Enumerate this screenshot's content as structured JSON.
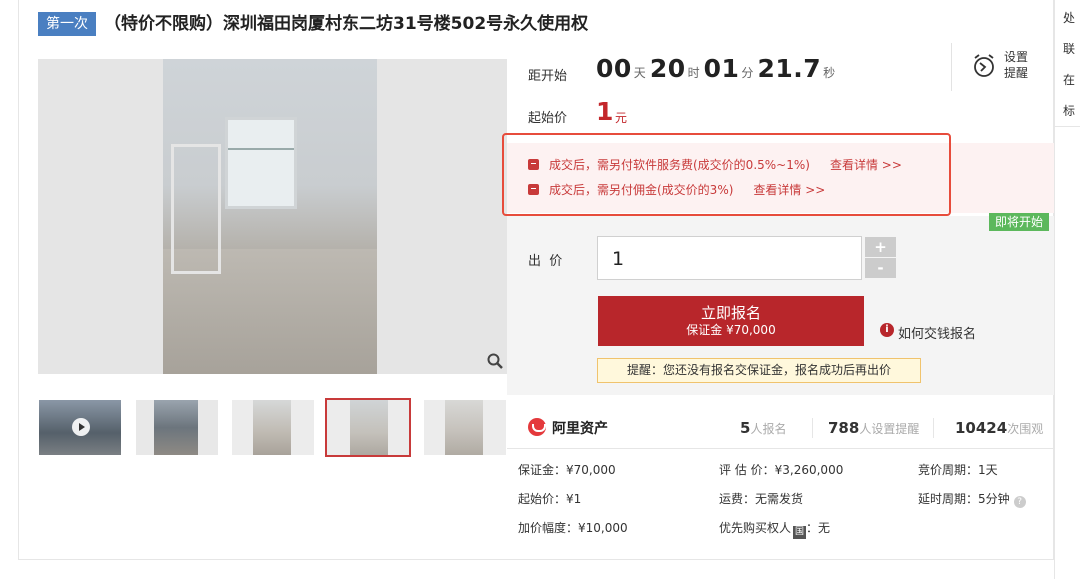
{
  "header": {
    "round_tag": "第一次",
    "title": "（特价不限购）深圳福田岗厦村东二坊31号楼502号永久使用权"
  },
  "right_strip": [
    "处",
    "联",
    "在",
    "标"
  ],
  "gallery": {
    "thumbnails": [
      {
        "label": "video-thumb",
        "active": false
      },
      {
        "label": "building-thumb",
        "active": false
      },
      {
        "label": "room-thumb",
        "active": false
      },
      {
        "label": "room-window-thumb",
        "active": true
      },
      {
        "label": "room-thumb-2",
        "active": false
      }
    ]
  },
  "countdown": {
    "label": "距开始",
    "days": "00",
    "days_unit": "天",
    "hours": "20",
    "hours_unit": "时",
    "minutes": "01",
    "minutes_unit": "分",
    "seconds": "21.7",
    "seconds_unit": "秒"
  },
  "reminder_setting": {
    "line1": "设置",
    "line2": "提醒"
  },
  "start_price": {
    "label": "起始价",
    "value": "1",
    "unit": "元"
  },
  "notices": [
    {
      "text": "成交后，需另付软件服务费(成交价的0.5%~1%)",
      "link": "查看详情 >>"
    },
    {
      "text": "成交后，需另付佣金(成交价的3%)",
      "link": "查看详情 >>"
    }
  ],
  "status_badge": "即将开始",
  "bid": {
    "label": "出  价",
    "value": "1",
    "plus": "+",
    "minus": "-"
  },
  "signup": {
    "title": "立即报名",
    "deposit": "保证金 ¥70,000"
  },
  "how_to_pay": "如何交钱报名",
  "reminder_text": "提醒：您还没有报名交保证金，报名成功后再出价",
  "platform": {
    "name": "阿里资产"
  },
  "stats": [
    {
      "num": "5",
      "label": "人报名"
    },
    {
      "num": "788",
      "label": "人设置提醒"
    },
    {
      "num": "10424",
      "label": "次围观"
    }
  ],
  "info": {
    "deposit": "保证金：¥70,000",
    "appraisal": "评 估 价：¥3,260,000",
    "period": "竞价周期：1天",
    "start": "起始价：¥1",
    "shipping": "运费：无需发货",
    "delay": "延时周期：5分钟",
    "increment": "加价幅度：¥10,000",
    "priority_prefix": "优先购买权人",
    "priority_badge": "国",
    "priority_value": "：无"
  },
  "colors": {
    "accent_red": "#b8262b",
    "tag_blue": "#4a7fc1",
    "badge_green": "#5cb85c"
  }
}
